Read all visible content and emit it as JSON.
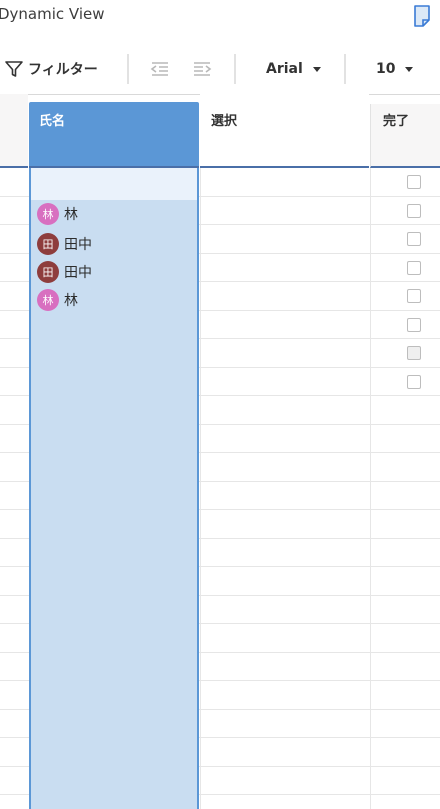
{
  "window": {
    "title": "Dynamic View"
  },
  "toolbar": {
    "filter_label": "フィルター",
    "font_family": "Arial",
    "font_size": "10"
  },
  "columns": {
    "name": "氏名",
    "select": "選択",
    "done": "完了"
  },
  "people": [
    {
      "initial": "林",
      "name": "林",
      "color": "#d86fc0"
    },
    {
      "initial": "田",
      "name": "田中",
      "color": "#8e3d3d"
    },
    {
      "initial": "田",
      "name": "田中",
      "color": "#8e3d3d"
    },
    {
      "initial": "林",
      "name": "林",
      "color": "#d86fc0"
    }
  ],
  "checkbox_rows": 8,
  "colors": {
    "accent": "#5b97d6",
    "selection": "#c9ddf1",
    "header_underline": "#4a6fa8"
  }
}
